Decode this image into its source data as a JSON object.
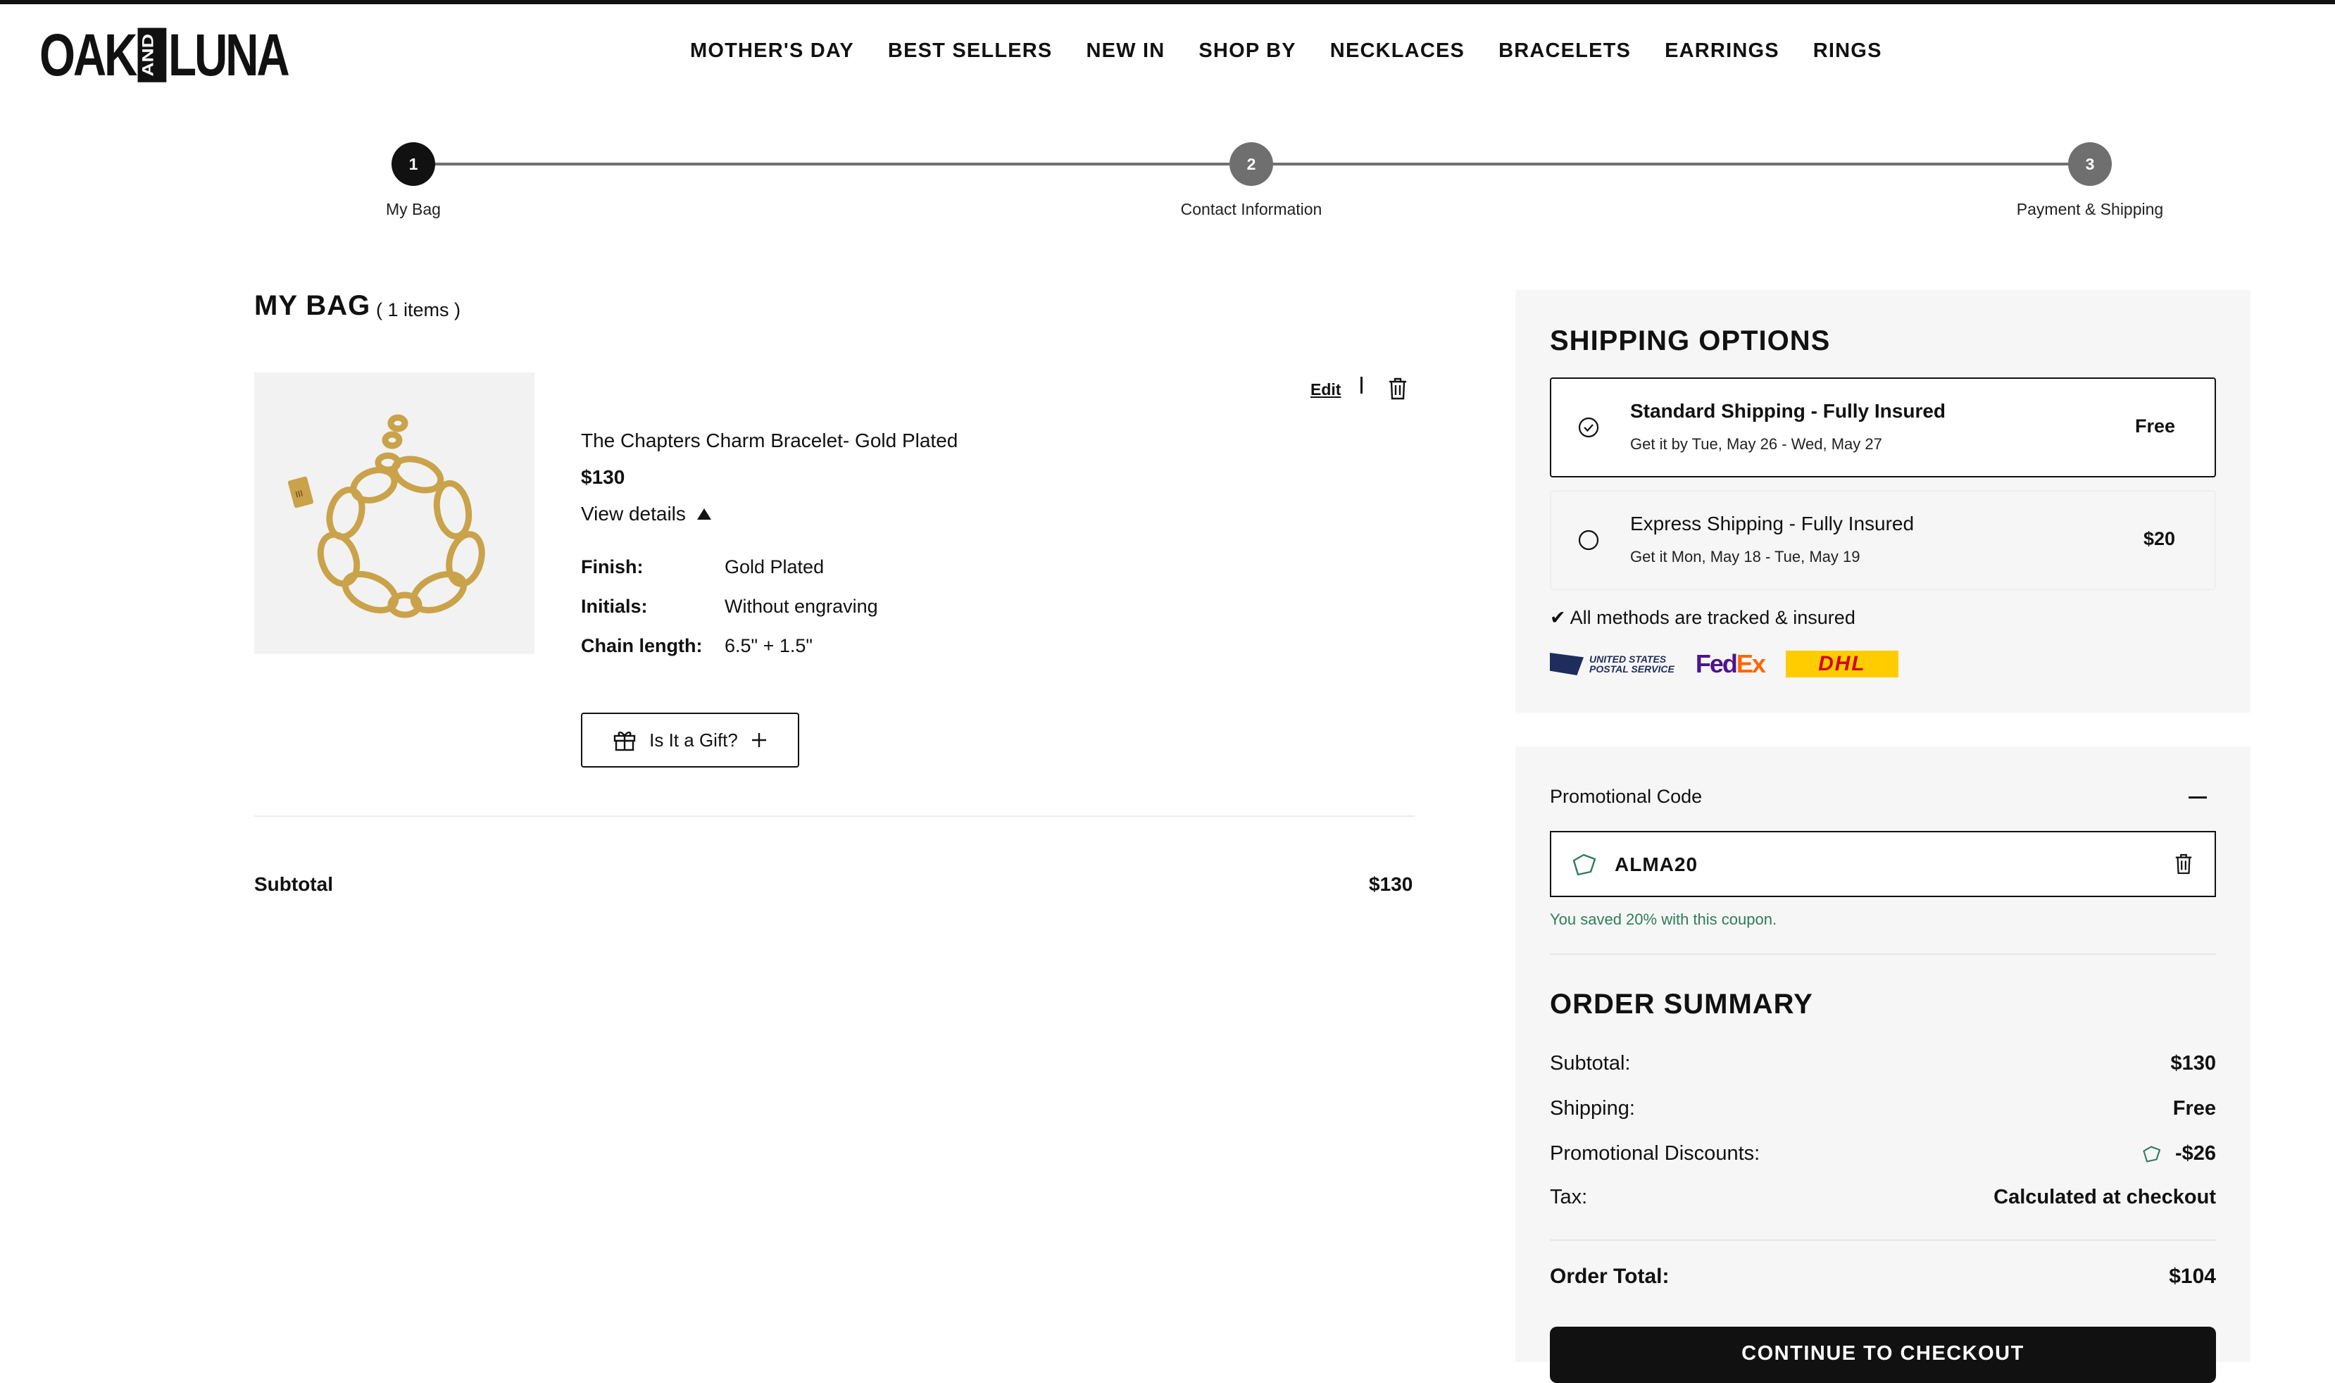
{
  "brand": {
    "logo_left": "OAK",
    "logo_mid": "AND",
    "logo_right": "LUNA"
  },
  "nav": [
    "MOTHER'S DAY",
    "BEST SELLERS",
    "NEW IN",
    "SHOP BY",
    "NECKLACES",
    "BRACELETS",
    "EARRINGS",
    "RINGS"
  ],
  "stepper": [
    {
      "num": "1",
      "label": "My Bag"
    },
    {
      "num": "2",
      "label": "Contact Information"
    },
    {
      "num": "3",
      "label": "Payment & Shipping"
    }
  ],
  "bag": {
    "title": "MY BAG",
    "count": "( 1 items )",
    "edit_label": "Edit",
    "item": {
      "name": "The Chapters Charm Bracelet- Gold Plated",
      "price": "$130",
      "view_details": "View details",
      "details": [
        {
          "key": "Finish:",
          "value": "Gold Plated"
        },
        {
          "key": "Initials:",
          "value": "Without engraving"
        },
        {
          "key": "Chain length:",
          "value": "6.5\" + 1.5\""
        }
      ]
    },
    "gift_label": "Is It a Gift?",
    "subtotal_label": "Subtotal",
    "subtotal_value": "$130"
  },
  "shipping": {
    "title": "SHIPPING OPTIONS",
    "options": [
      {
        "name": "Standard Shipping - Fully Insured",
        "date": "Get it by Tue, May 26 - Wed, May 27",
        "price": "Free",
        "selected": true
      },
      {
        "name": "Express Shipping - Fully Insured",
        "date": "Get it Mon, May 18 - Tue, May 19",
        "price": "$20",
        "selected": false
      }
    ],
    "tracked": "✔ All methods are tracked & insured",
    "carriers": {
      "usps_line1": "UNITED STATES",
      "usps_line2": "POSTAL SERVICE",
      "fedex_fed": "Fed",
      "fedex_ex": "Ex",
      "dhl": "DHL"
    }
  },
  "promo": {
    "heading": "Promotional Code",
    "code": "ALMA20",
    "saved_message": "You saved 20% with this coupon."
  },
  "summary": {
    "title": "ORDER SUMMARY",
    "rows": [
      {
        "label": "Subtotal:",
        "value": "$130"
      },
      {
        "label": "Shipping:",
        "value": "Free"
      },
      {
        "label": "Promotional Discounts:",
        "value": "-$26"
      },
      {
        "label": "Tax:",
        "value": "Calculated at checkout"
      }
    ],
    "total_label": "Order Total:",
    "total_value": "$104",
    "checkout_label": "CONTINUE TO CHECKOUT"
  },
  "colors": {
    "accent": "#111111",
    "panel_bg": "#f6f6f6",
    "success": "#2e7d5b",
    "step_inactive": "#6f6f6f"
  }
}
